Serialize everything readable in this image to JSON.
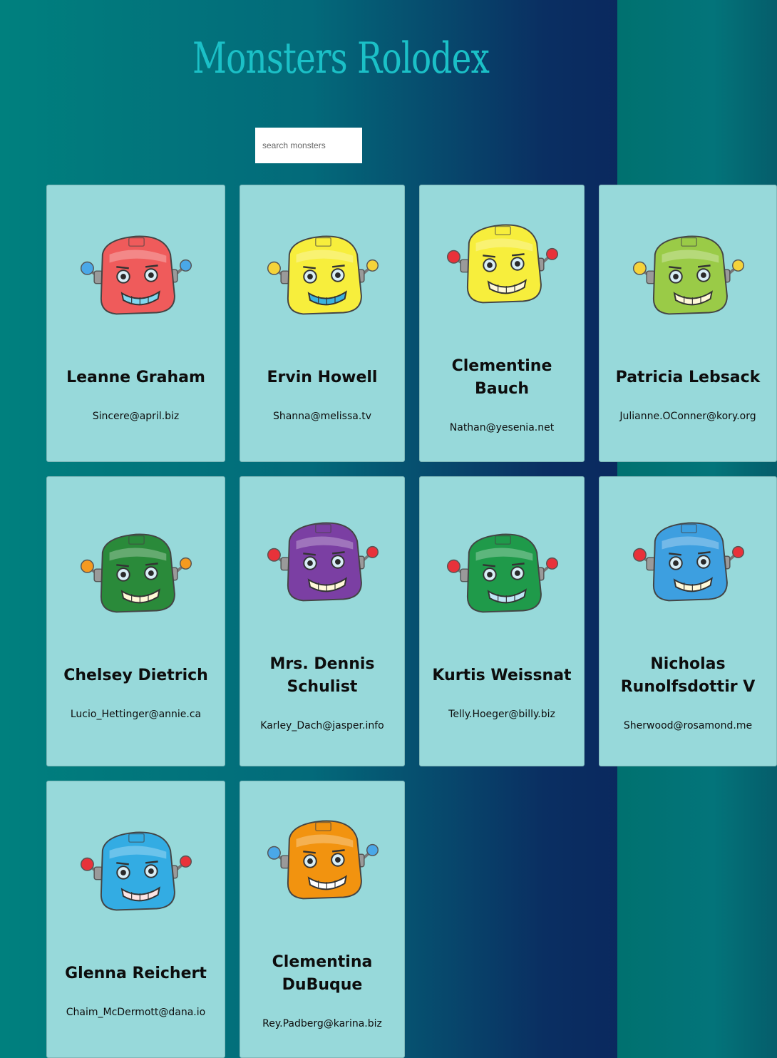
{
  "app": {
    "title": "Monsters Rolodex"
  },
  "search": {
    "placeholder": "search monsters",
    "value": ""
  },
  "monsters": [
    {
      "name": "Leanne Graham",
      "email": "Sincere@april.biz",
      "head_color": "#ef5b5b",
      "mouth_color": "#80d8f0",
      "icon": "robot-head-icon"
    },
    {
      "name": "Ervin Howell",
      "email": "Shanna@melissa.tv",
      "head_color": "#f7ee3c",
      "mouth_color": "#3ab3e0",
      "icon": "robot-head-icon"
    },
    {
      "name": "Clementine Bauch",
      "email": "Nathan@yesenia.net",
      "head_color": "#f7ee3c",
      "mouth_color": "#fff9d8",
      "icon": "robot-head-icon"
    },
    {
      "name": "Patricia Lebsack",
      "email": "Julianne.OConner@kory.org",
      "head_color": "#9acb47",
      "mouth_color": "#fff9d8",
      "icon": "robot-head-icon"
    },
    {
      "name": "Chelsey Dietrich",
      "email": "Lucio_Hettinger@annie.ca",
      "head_color": "#2a8a3a",
      "mouth_color": "#fff9d8",
      "icon": "robot-head-icon"
    },
    {
      "name": "Mrs. Dennis Schulist",
      "email": "Karley_Dach@jasper.info",
      "head_color": "#7b3fa3",
      "mouth_color": "#fff9d8",
      "icon": "robot-head-icon"
    },
    {
      "name": "Kurtis Weissnat",
      "email": "Telly.Hoeger@billy.biz",
      "head_color": "#1f9a4a",
      "mouth_color": "#bfe6f5",
      "icon": "robot-head-icon"
    },
    {
      "name": "Nicholas Runolfsdottir V",
      "email": "Sherwood@rosamond.me",
      "head_color": "#3d9fe0",
      "mouth_color": "#fff9d8",
      "icon": "robot-head-icon"
    },
    {
      "name": "Glenna Reichert",
      "email": "Chaim_McDermott@dana.io",
      "head_color": "#33ace3",
      "mouth_color": "#fde4e4",
      "icon": "robot-head-icon"
    },
    {
      "name": "Clementina DuBuque",
      "email": "Rey.Padberg@karina.biz",
      "head_color": "#f2930f",
      "mouth_color": "#ffffff",
      "icon": "robot-head-icon"
    }
  ]
}
